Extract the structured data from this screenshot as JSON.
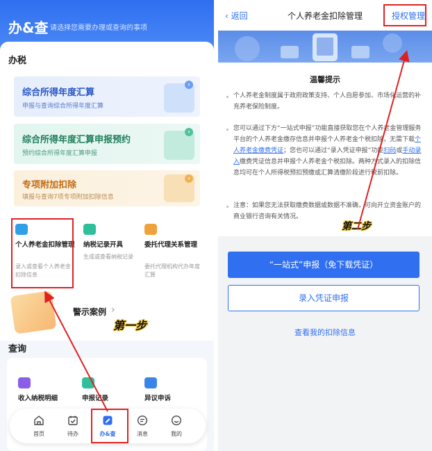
{
  "left": {
    "header": {
      "title": "办&查",
      "subtitle": "请选择您需要办理或查询的事项"
    },
    "tax_section": {
      "title": "办税"
    },
    "cards": [
      {
        "title": "综合所得年度汇算",
        "subtitle": "申报与查询综合所得年度汇算"
      },
      {
        "title": "综合所得年度汇算申报预约",
        "subtitle": "预约综合所得年度汇算申报"
      },
      {
        "title": "专项附加扣除",
        "subtitle": "填报与查询7项专项附加扣除信息"
      }
    ],
    "tiles": [
      {
        "title": "个人养老金扣除管理",
        "subtitle": "录入或查看个人养老金扣除信息"
      },
      {
        "title": "纳税记录开具",
        "subtitle": "生成或查看纳税记录"
      },
      {
        "title": "委托代理关系管理",
        "subtitle": "委托代理机构代办年度汇算"
      }
    ],
    "warning": {
      "label": "警示案例"
    },
    "step1": "第一步",
    "query_section": {
      "title": "查询"
    },
    "query_tiles": [
      {
        "title": "收入纳税明细"
      },
      {
        "title": "申报记录"
      },
      {
        "title": "异议申诉"
      }
    ],
    "tabs": [
      {
        "label": "首页",
        "icon": "home-icon"
      },
      {
        "label": "待办",
        "icon": "calendar-check-icon"
      },
      {
        "label": "办&查",
        "icon": "document-pen-icon"
      },
      {
        "label": "消息",
        "icon": "message-icon"
      },
      {
        "label": "我的",
        "icon": "smile-icon"
      }
    ],
    "active_tab": "办&查"
  },
  "right": {
    "nav": {
      "back": "返回",
      "title": "个人养老金扣除管理",
      "auth": "授权管理"
    },
    "tip_title": "温馨提示",
    "para1": "个人养老金制度属于政府政策支持、个人自愿参加、市场化运营的补充养老保险制度。",
    "para2": {
      "a": "您可以通过下方“一站式申报”功能直接获取您在个人养老金管理服务平台的个人养老金缴存信息并申报个人养老金个税扣除，无需下载",
      "link1": "个人养老金缴费凭证",
      "b": "；您也可以通过“录入凭证申报”功能",
      "link2": "扫码",
      "c": "或",
      "link3": "手动录入",
      "d": "缴费凭证信息并申报个人养老金个税扣除。两种方式录入的扣除信息均可在个人所得税预扣预缴或汇算清缴阶段进行税前扣除。"
    },
    "para3": "注意：如果您无法获取缴费数据或数据不准确，可向开立资金账户的商业银行咨询有关情况。",
    "step2": "第二步",
    "btn_primary": "“一站式”申报（免下载凭证）",
    "btn_secondary": "录入凭证申报",
    "view_link": "查看我的扣除信息"
  },
  "colors": {
    "accent": "#2f6ff0",
    "annotation": "#e02020",
    "step_highlight": "#f5c83a"
  }
}
